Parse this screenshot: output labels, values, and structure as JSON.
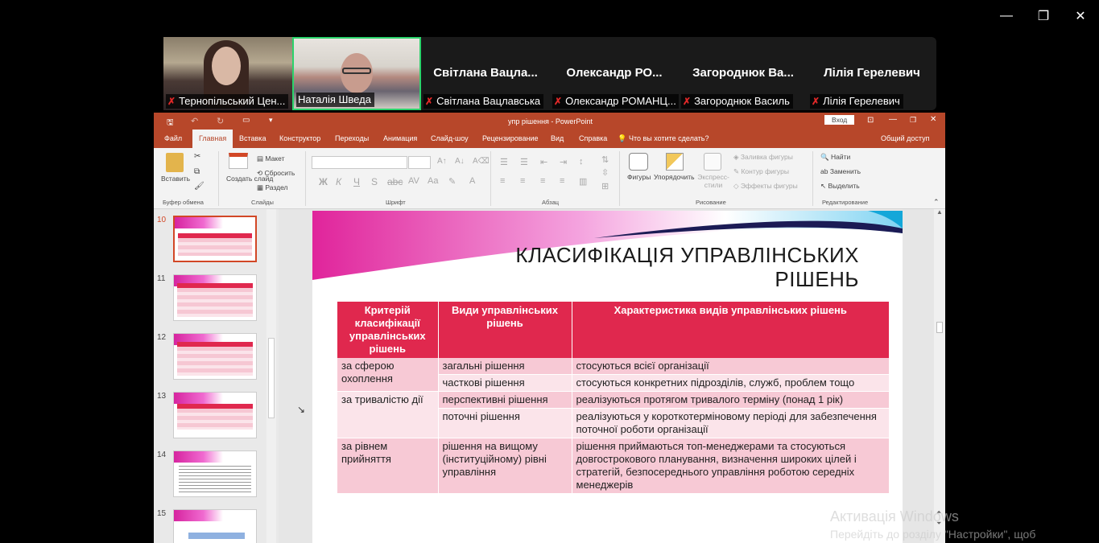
{
  "window_controls": {
    "minimize": "—",
    "restore": "❐",
    "close": "✕"
  },
  "participants": [
    {
      "name": "Тернопільський Цен...",
      "video": true
    },
    {
      "name": "Наталія Шведа",
      "video": true,
      "active_speaker": true
    },
    {
      "big": "Світлана  Вацла...",
      "name": "Світлана Вацлавська"
    },
    {
      "big": "Олександр  РО...",
      "name": "Олександр РОМАНЦ..."
    },
    {
      "big": "Загороднюк  Ва...",
      "name": "Загороднюк Василь"
    },
    {
      "big": "Лілія Герелевич",
      "name": "Лілія Герелевич"
    }
  ],
  "powerpoint": {
    "title": "упр рішення  -  PowerPoint",
    "login": "Вход",
    "tabs": [
      "Файл",
      "Главная",
      "Вставка",
      "Конструктор",
      "Переходы",
      "Анимация",
      "Слайд-шоу",
      "Рецензирование",
      "Вид",
      "Справка"
    ],
    "tell_me": "Что вы хотите сделать?",
    "share": "Общий доступ",
    "ribbon": {
      "paste": "Вставить",
      "clipboard": "Буфер обмена",
      "new_slide": "Создать слайд",
      "layout": "Макет",
      "reset": "Сбросить",
      "section": "Раздел",
      "slides": "Слайды",
      "font": "Шрифт",
      "paragraph": "Абзац",
      "shapes": "Фигуры",
      "arrange": "Упорядочить",
      "quick_styles": "Экспресс-стили",
      "shape_fill": "Заливка фигуры",
      "shape_outline": "Контур фигуры",
      "shape_effects": "Эффекты фигуры",
      "drawing": "Рисование",
      "find": "Найти",
      "replace": "Заменить",
      "select": "Выделить",
      "editing": "Редактирование"
    },
    "thumbs": [
      "10",
      "11",
      "12",
      "13",
      "14",
      "15"
    ]
  },
  "slide": {
    "title_line1": "КЛАСИФІКАЦІЯ УПРАВЛІНСЬКИХ",
    "title_line2": "РІШЕНЬ",
    "headers": [
      "Критерій класифікації управлінських рішень",
      "Види управлінських рішень",
      "Характеристика видів управлінських рішень"
    ],
    "rows": [
      [
        "за сферою охоплення",
        "загальні рішення",
        "стосуються всієї організації"
      ],
      [
        "",
        "часткові рішення",
        "стосуються конкретних підрозділів, служб, проблем тощо"
      ],
      [
        "за тривалістю дії",
        "перспективні рішення",
        "реалізуються протягом тривалого терміну (понад 1 рік)"
      ],
      [
        "",
        "поточні рішення",
        "реалізуються у короткотерміновому періоді для забезпечення поточної роботи організації"
      ],
      [
        "за рівнем прийняття",
        "рішення на вищому (інституційному) рівні управління",
        "рішення приймаються топ-менеджерами та стосуються довгострокового планування, визначення широких цілей і стратегій, безпосереднього управління роботою середніх менеджерів"
      ]
    ]
  },
  "activation": {
    "line1": "Активація Windows",
    "line2": "Перейдіть до розділу \"Настройки\", щоб"
  },
  "colors": {
    "accent": "#b7472a",
    "table_header": "#e0284e",
    "speaker_border": "#2bd36b"
  }
}
